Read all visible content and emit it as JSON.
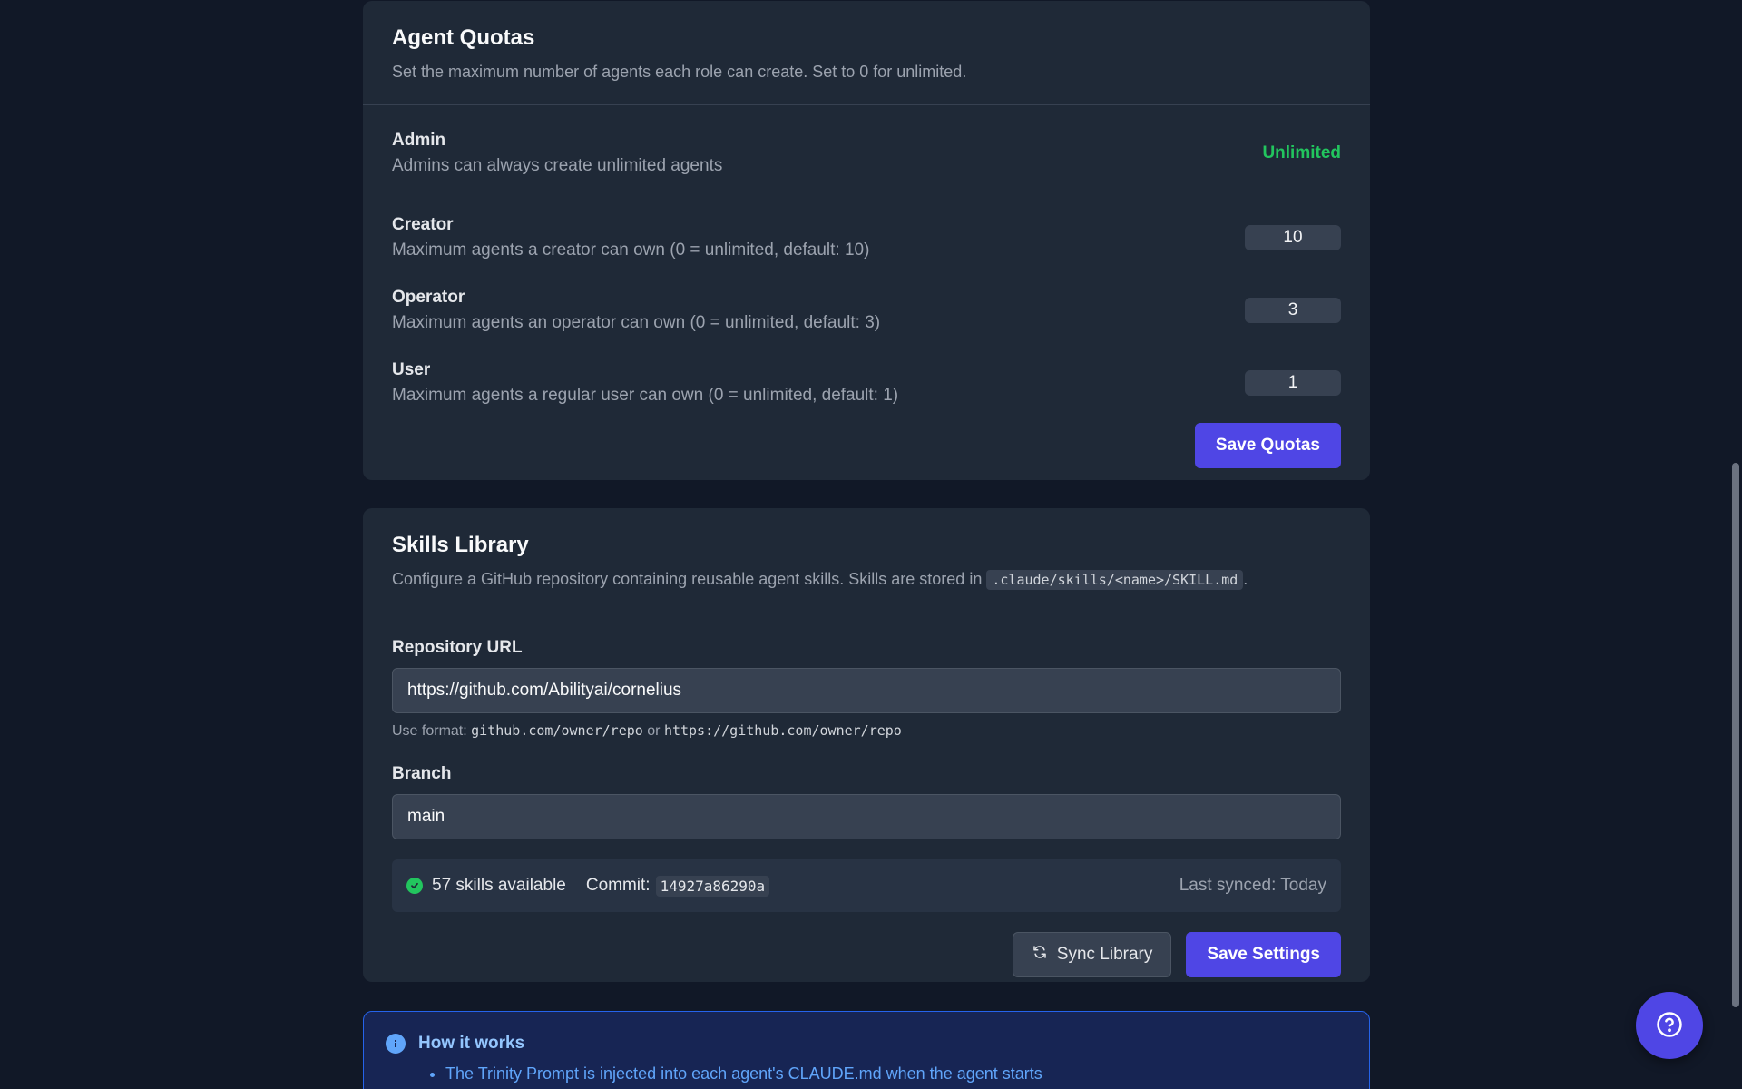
{
  "quotas": {
    "title": "Agent Quotas",
    "description": "Set the maximum number of agents each role can create. Set to 0 for unlimited.",
    "admin": {
      "name": "Admin",
      "help": "Admins can always create unlimited agents",
      "value": "Unlimited"
    },
    "creator": {
      "name": "Creator",
      "help": "Maximum agents a creator can own (0 = unlimited, default: 10)",
      "value": "10"
    },
    "operator": {
      "name": "Operator",
      "help": "Maximum agents an operator can own (0 = unlimited, default: 3)",
      "value": "3"
    },
    "user": {
      "name": "User",
      "help": "Maximum agents a regular user can own (0 = unlimited, default: 1)",
      "value": "1"
    },
    "save_label": "Save Quotas"
  },
  "skills": {
    "title": "Skills Library",
    "description_prefix": "Configure a GitHub repository containing reusable agent skills. Skills are stored in",
    "description_path": ".claude/skills/<name>/SKILL.md",
    "description_suffix": ".",
    "repo_label": "Repository URL",
    "repo_value": "https://github.com/Abilityai/cornelius",
    "hint_prefix": "Use format:",
    "hint_format1": "github.com/owner/repo",
    "hint_or": "or",
    "hint_format2": "https://github.com/owner/repo",
    "branch_label": "Branch",
    "branch_value": "main",
    "status_count": "57 skills available",
    "commit_label": "Commit:",
    "commit_hash": "14927a86290a",
    "last_synced": "Last synced: Today",
    "sync_label": "Sync Library",
    "save_label": "Save Settings"
  },
  "info": {
    "title": "How it works",
    "items": [
      "The Trinity Prompt is injected into each agent's CLAUDE.md when the agent starts"
    ]
  },
  "colors": {
    "accent": "#4f46e5",
    "success": "#22c55e",
    "info": "#60a5fa"
  },
  "icons": {
    "status": "check-circle-icon",
    "sync": "refresh-icon",
    "info": "info-icon",
    "help": "help-circle-icon"
  }
}
